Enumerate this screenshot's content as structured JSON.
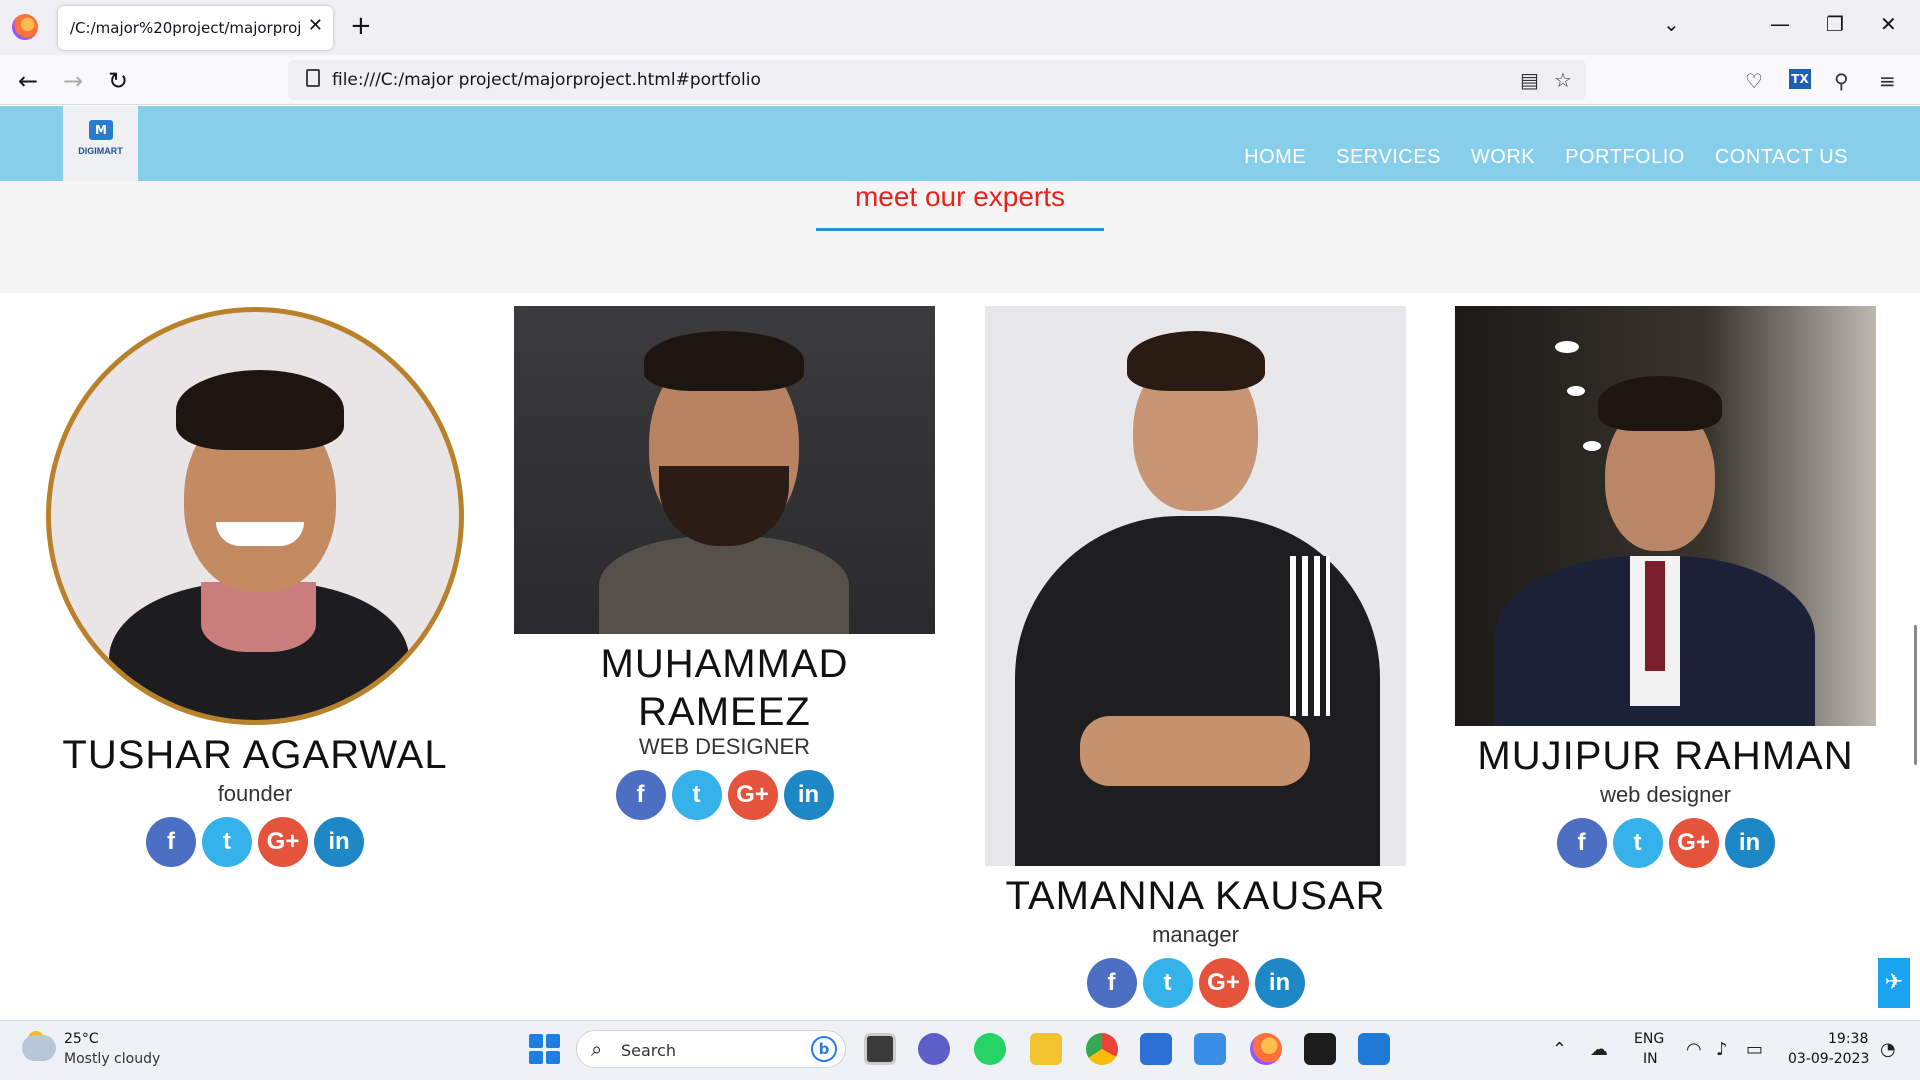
{
  "browser": {
    "tab_title": "/C:/major%20project/majorproject.html",
    "url": "file:///C:/major project/majorproject.html#portfolio",
    "tx_label": "TX"
  },
  "site": {
    "logo_text": "DIGIMART",
    "logo_mark": "M",
    "menu": [
      "HOME",
      "SERVICES",
      "WORK",
      "PORTFOLIO",
      "CONTACT US"
    ],
    "section_title": "meet our experts",
    "members": [
      {
        "name": "TUSHAR AGARWAL",
        "role": "founder"
      },
      {
        "name": "MUHAMMAD RAMEEZ",
        "role": "WEB DESIGNER"
      },
      {
        "name": "TAMANNA KAUSAR",
        "role": "manager"
      },
      {
        "name": "MUJIPUR RAHMAN",
        "role": "web designer"
      }
    ],
    "social_labels": {
      "facebook": "f",
      "twitter": "t",
      "google": "G+",
      "linkedin": "in"
    },
    "scroll_top_glyph": "✈"
  },
  "taskbar": {
    "temperature": "25°C",
    "weather": "Mostly cloudy",
    "search_placeholder": "Search",
    "language": "ENG",
    "region": "IN",
    "time": "19:38",
    "date": "03-09-2023"
  }
}
